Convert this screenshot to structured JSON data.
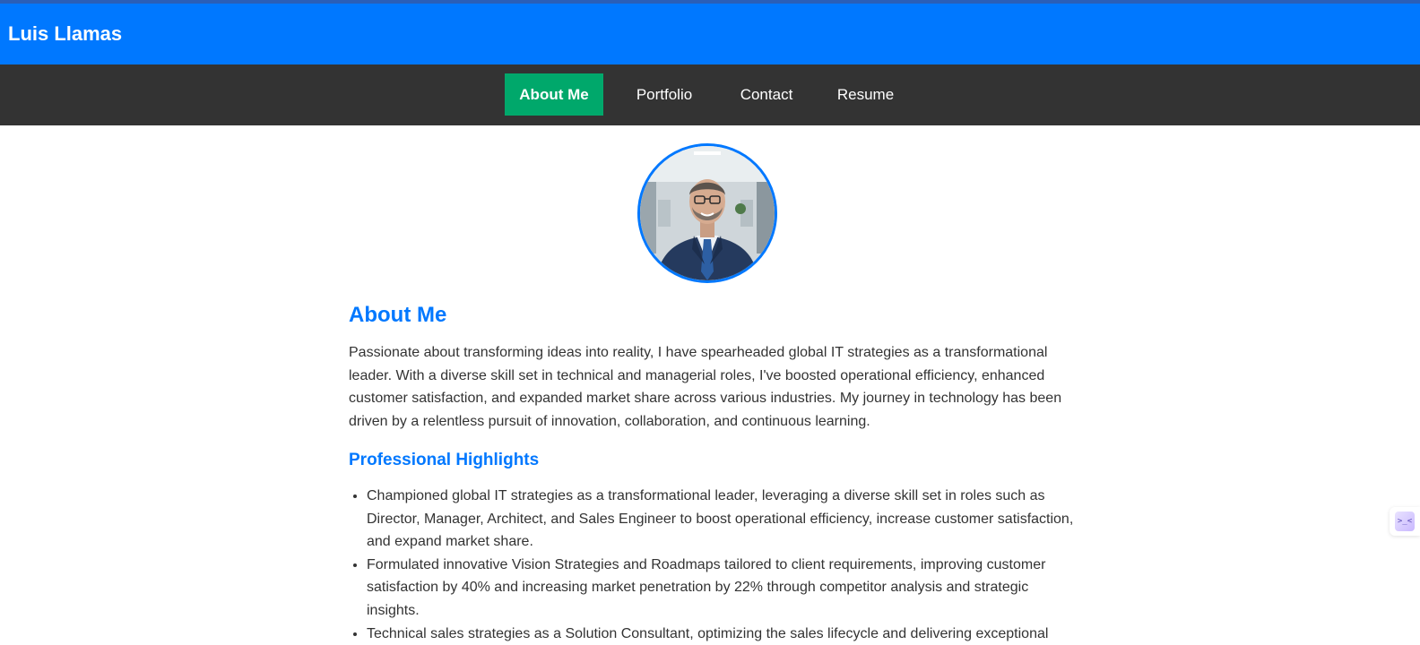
{
  "header": {
    "title": "Luis Llamas"
  },
  "nav": {
    "items": [
      {
        "label": "About Me",
        "active": true
      },
      {
        "label": "Portfolio",
        "active": false
      },
      {
        "label": "Contact",
        "active": false
      },
      {
        "label": "Resume",
        "active": false
      }
    ]
  },
  "profile": {
    "photo": "profile-photo"
  },
  "about": {
    "heading": "About Me",
    "text": "Passionate about transforming ideas into reality, I have spearheaded global IT strategies as a transformational leader. With a diverse skill set in technical and managerial roles, I've boosted operational efficiency, enhanced customer satisfaction, and expanded market share across various industries. My journey in technology has been driven by a relentless pursuit of innovation, collaboration, and continuous learning."
  },
  "highlights": {
    "heading": "Professional Highlights",
    "items": [
      "Championed global IT strategies as a transformational leader, leveraging a diverse skill set in roles such as Director, Manager, Architect, and Sales Engineer to boost operational efficiency, increase customer satisfaction, and expand market share.",
      "Formulated innovative Vision Strategies and Roadmaps tailored to client requirements, improving customer satisfaction by 40% and increasing market penetration by 22% through competitor analysis and strategic insights.",
      "Technical sales strategies as a Solution Consultant, optimizing the sales lifecycle and delivering exceptional"
    ]
  },
  "widget": {
    "icon": "code-assistant-icon",
    "glyph": ">_<"
  },
  "colors": {
    "header_bg": "#0078ff",
    "nav_bg": "#333333",
    "nav_active": "#00a86b",
    "heading": "#0078ff",
    "body_text": "#333333"
  }
}
